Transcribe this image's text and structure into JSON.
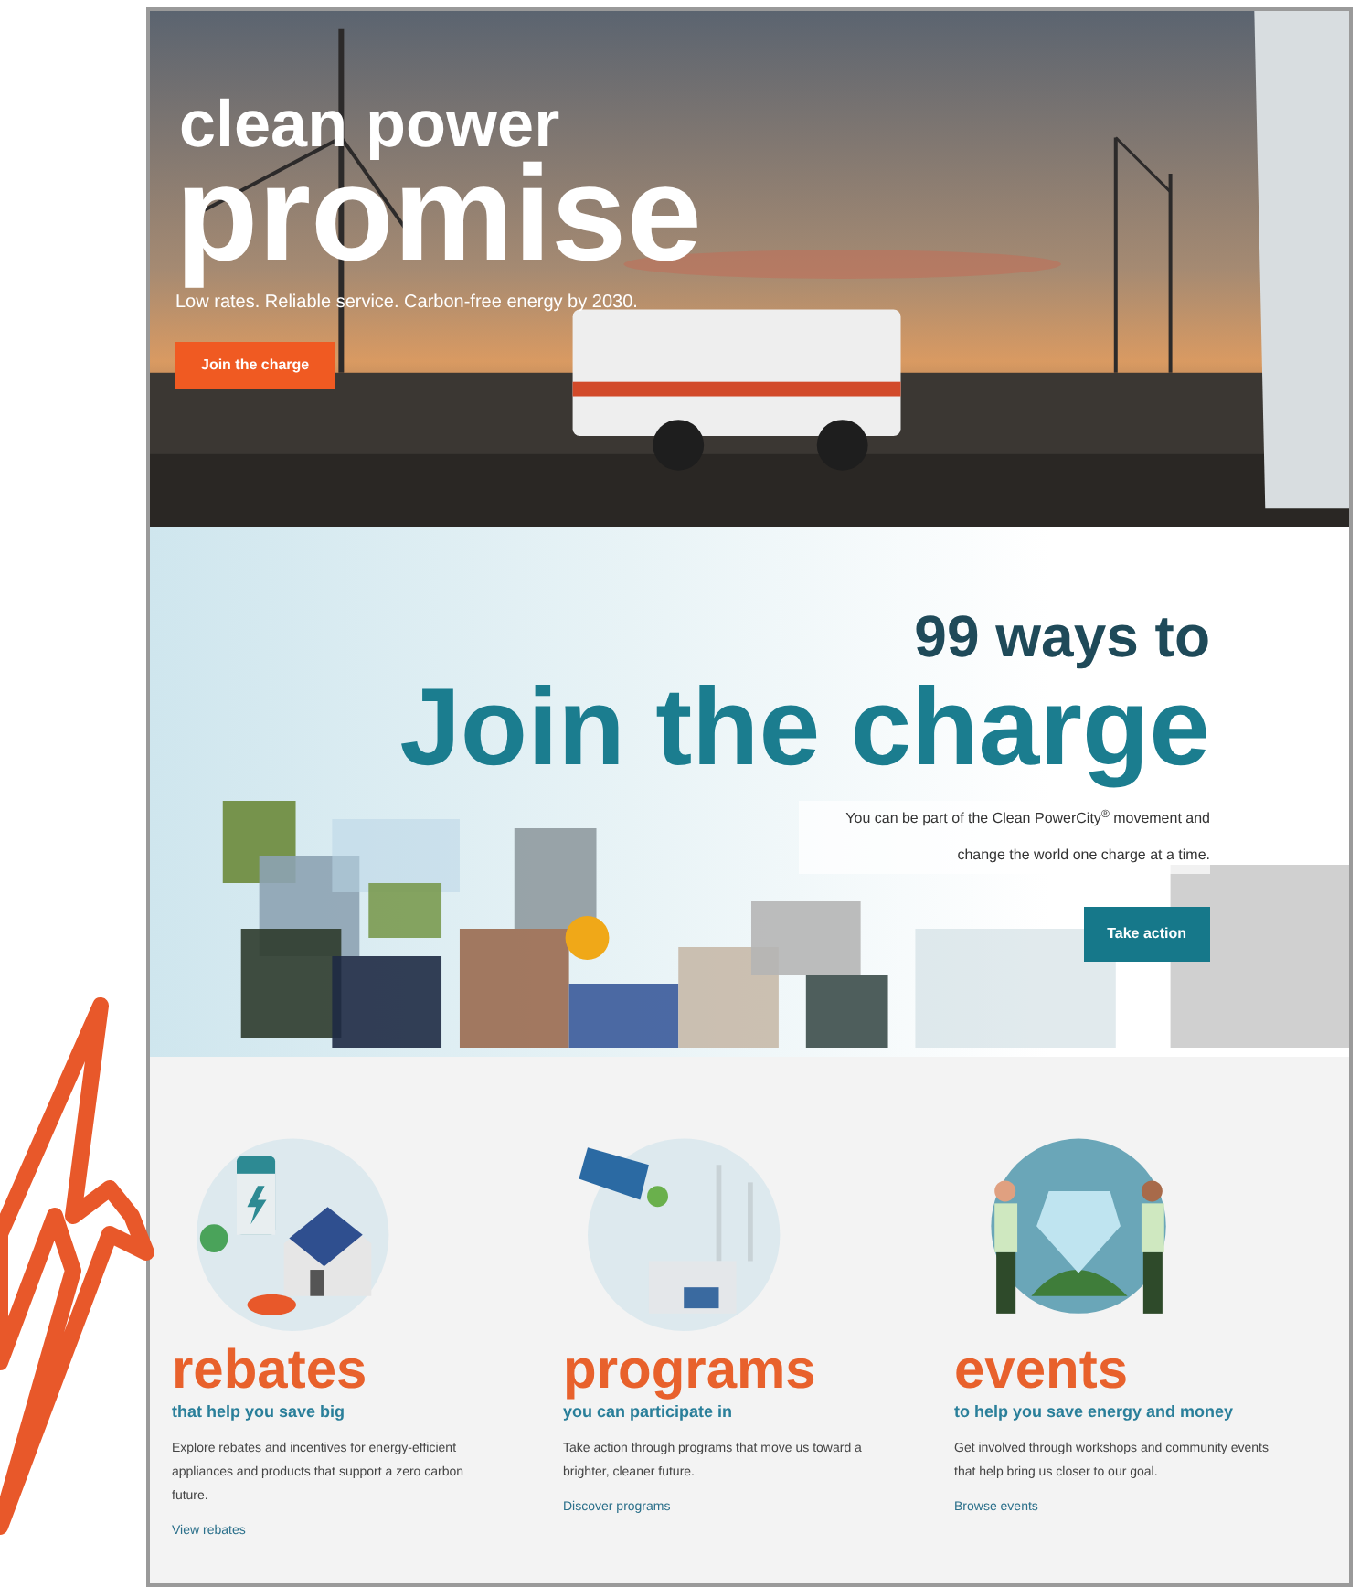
{
  "hero": {
    "title_small": "clean power",
    "title_large": "promise",
    "tagline": "Low rates. Reliable service. Carbon-free energy by 2030.",
    "button": "Join the charge"
  },
  "campaign": {
    "kicker": "99 ways to",
    "headline": "Join the charge",
    "description": "You can be part of the Clean PowerCity$^{®}$ movement and change the world one charge at a time.",
    "button": "Take action"
  },
  "features": [
    {
      "kind": "house",
      "title": "rebates",
      "subtitle": "that help you save big",
      "description": "Explore rebates and incentives for energy-efficient appliances and products that support a zero carbon future.",
      "link": "View rebates"
    },
    {
      "kind": "renewables",
      "title": "programs",
      "subtitle": "you can participate in",
      "description": "Take action through programs that move us toward a brighter, cleaner future.",
      "link": "Discover programs"
    },
    {
      "kind": "people",
      "title": "events",
      "subtitle": "to help you save energy and money",
      "description": "Get involved through workshops and community events that help bring us closer to our goal.",
      "link": "Browse events"
    }
  ]
}
